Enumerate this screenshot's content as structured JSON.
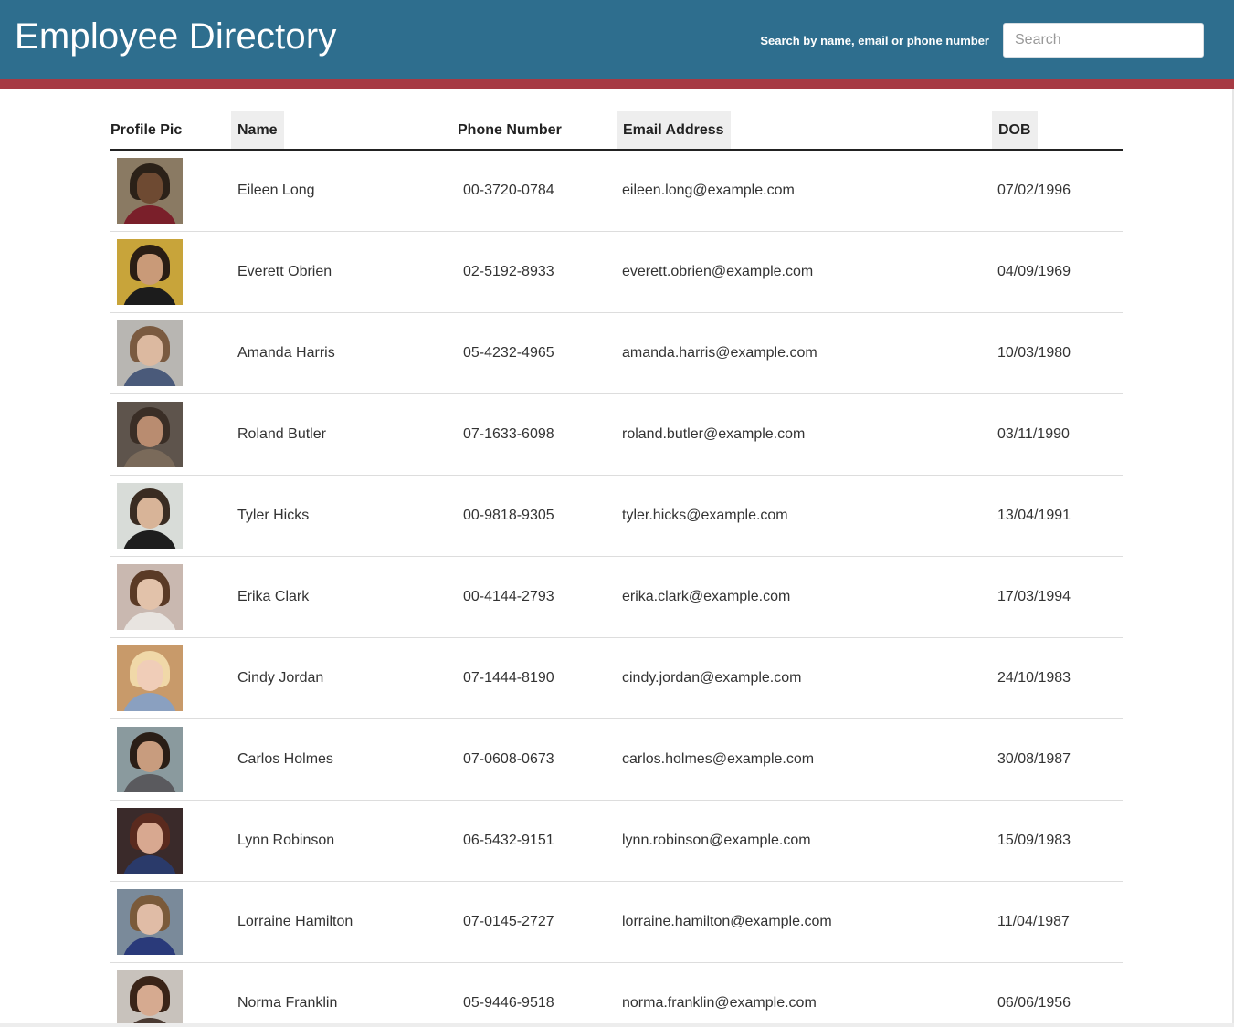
{
  "header": {
    "title": "Employee Directory",
    "search_label": "Search by name, email or phone number",
    "search_placeholder": "Search",
    "search_value": "",
    "colors": {
      "background": "#2e6e8e",
      "stripe": "#a63a44"
    }
  },
  "table": {
    "columns": [
      {
        "key": "pic",
        "label": "Profile Pic",
        "sortable": false
      },
      {
        "key": "name",
        "label": "Name",
        "sortable": true
      },
      {
        "key": "phone",
        "label": "Phone Number",
        "sortable": false
      },
      {
        "key": "email",
        "label": "Email Address",
        "sortable": true
      },
      {
        "key": "dob",
        "label": "DOB",
        "sortable": true
      }
    ],
    "rows": [
      {
        "name": "Eileen Long",
        "phone": "00-3720-0784",
        "email": "eileen.long@example.com",
        "dob": "07/02/1996",
        "avatar": {
          "bg": "#8a7a63",
          "hair": "#2b2118",
          "skin": "#6e4a32",
          "shirt": "#7a1f2a"
        }
      },
      {
        "name": "Everett Obrien",
        "phone": "02-5192-8933",
        "email": "everett.obrien@example.com",
        "dob": "04/09/1969",
        "avatar": {
          "bg": "#c8a43a",
          "hair": "#2a1d14",
          "skin": "#c99a78",
          "shirt": "#1c1c1c"
        }
      },
      {
        "name": "Amanda Harris",
        "phone": "05-4232-4965",
        "email": "amanda.harris@example.com",
        "dob": "10/03/1980",
        "avatar": {
          "bg": "#b8b6b2",
          "hair": "#7a5a40",
          "skin": "#dcb9a0",
          "shirt": "#4a5a7a"
        }
      },
      {
        "name": "Roland Butler",
        "phone": "07-1633-6098",
        "email": "roland.butler@example.com",
        "dob": "03/11/1990",
        "avatar": {
          "bg": "#5e544c",
          "hair": "#3a2e26",
          "skin": "#b98c70",
          "shirt": "#7a6a5a"
        }
      },
      {
        "name": "Tyler Hicks",
        "phone": "00-9818-9305",
        "email": "tyler.hicks@example.com",
        "dob": "13/04/1991",
        "avatar": {
          "bg": "#d8dcd8",
          "hair": "#3a2c22",
          "skin": "#d8b498",
          "shirt": "#1e1e1e"
        }
      },
      {
        "name": "Erika Clark",
        "phone": "00-4144-2793",
        "email": "erika.clark@example.com",
        "dob": "17/03/1994",
        "avatar": {
          "bg": "#c9b8b0",
          "hair": "#5a3a26",
          "skin": "#e2c2aa",
          "shirt": "#e8e4e0"
        }
      },
      {
        "name": "Cindy Jordan",
        "phone": "07-1444-8190",
        "email": "cindy.jordan@example.com",
        "dob": "24/10/1983",
        "avatar": {
          "bg": "#c89a6a",
          "hair": "#f0d8a8",
          "skin": "#f0cdb8",
          "shirt": "#8aa0c0"
        }
      },
      {
        "name": "Carlos Holmes",
        "phone": "07-0608-0673",
        "email": "carlos.holmes@example.com",
        "dob": "30/08/1987",
        "avatar": {
          "bg": "#8a9a9e",
          "hair": "#2a1e16",
          "skin": "#c89c7e",
          "shirt": "#5a5a5e"
        }
      },
      {
        "name": "Lynn Robinson",
        "phone": "06-5432-9151",
        "email": "lynn.robinson@example.com",
        "dob": "15/09/1983",
        "avatar": {
          "bg": "#3a2a2a",
          "hair": "#5a2a1e",
          "skin": "#d8a890",
          "shirt": "#2a3a6a"
        }
      },
      {
        "name": "Lorraine Hamilton",
        "phone": "07-0145-2727",
        "email": "lorraine.hamilton@example.com",
        "dob": "11/04/1987",
        "avatar": {
          "bg": "#7a8a9a",
          "hair": "#7a5a3a",
          "skin": "#e0bca6",
          "shirt": "#2a3a7a"
        }
      },
      {
        "name": "Norma Franklin",
        "phone": "05-9446-9518",
        "email": "norma.franklin@example.com",
        "dob": "06/06/1956",
        "avatar": {
          "bg": "#c8c2bc",
          "hair": "#3a2418",
          "skin": "#d6aa90",
          "shirt": "#4a3a32"
        }
      }
    ]
  }
}
